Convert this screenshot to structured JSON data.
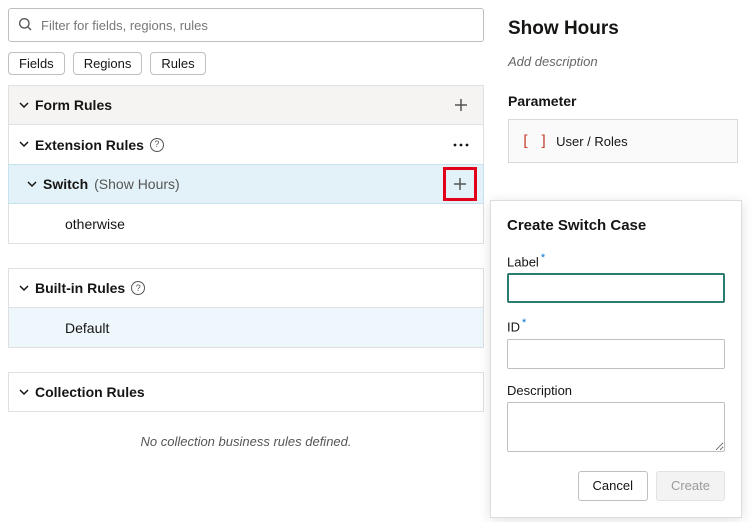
{
  "search": {
    "placeholder": "Filter for fields, regions, rules"
  },
  "chips": {
    "fields": "Fields",
    "regions": "Regions",
    "rules": "Rules"
  },
  "sections": {
    "form_rules": "Form Rules",
    "extension_rules": "Extension Rules",
    "builtin_rules": "Built-in Rules",
    "collection_rules": "Collection Rules"
  },
  "switch": {
    "label": "Switch",
    "hint": "(Show Hours)",
    "otherwise": "otherwise"
  },
  "builtin_default": "Default",
  "collection_empty": "No collection business rules defined.",
  "right_panel": {
    "title": "Show Hours",
    "subtitle": "Add description",
    "parameter_label": "Parameter",
    "parameter_value": "User / Roles"
  },
  "popover": {
    "title": "Create Switch Case",
    "label_label": "Label",
    "id_label": "ID",
    "description_label": "Description",
    "cancel": "Cancel",
    "create": "Create"
  }
}
